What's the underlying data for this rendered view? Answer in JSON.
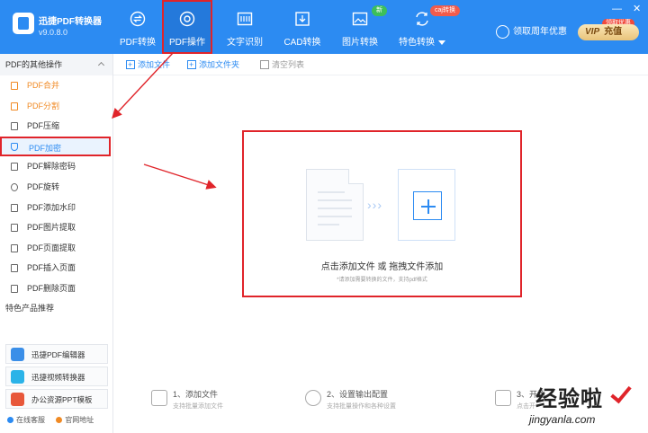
{
  "app": {
    "name": "迅捷PDF转换器",
    "version": "v9.0.8.0"
  },
  "nav": [
    {
      "label": "PDF转换",
      "icon": "convert-icon"
    },
    {
      "label": "PDF操作",
      "icon": "pdf-operate-icon",
      "active": true
    },
    {
      "label": "文字识别",
      "icon": "ocr-icon"
    },
    {
      "label": "CAD转换",
      "icon": "cad-icon"
    },
    {
      "label": "图片转换",
      "icon": "image-icon",
      "badge": "新"
    },
    {
      "label": "特色转换",
      "icon": "special-icon",
      "badge": "caj转换"
    }
  ],
  "header": {
    "user_label": "领取周年优惠",
    "vip_label": "VIP",
    "recharge_label": "充值",
    "vip_tag": "领取优惠"
  },
  "window_controls": {
    "minimize": "—",
    "close": "✕"
  },
  "sidebar": {
    "title": "PDF的其他操作",
    "items": [
      {
        "label": "PDF合并",
        "style": "orange"
      },
      {
        "label": "PDF分割",
        "style": "orange"
      },
      {
        "label": "PDF压缩"
      },
      {
        "label": "PDF加密",
        "selected": true
      },
      {
        "label": "PDF解除密码"
      },
      {
        "label": "PDF旋转"
      },
      {
        "label": "PDF添加水印"
      },
      {
        "label": "PDF图片提取"
      },
      {
        "label": "PDF页面提取"
      },
      {
        "label": "PDF插入页面"
      },
      {
        "label": "PDF删除页面"
      }
    ],
    "recommend_title": "特色产品推荐",
    "recommend": [
      {
        "label": "迅捷PDF编辑器",
        "color": "#3b8fe8"
      },
      {
        "label": "迅捷视频转换器",
        "color": "#2bb3e8"
      },
      {
        "label": "办公资源PPT模板",
        "color": "#e8583b"
      }
    ],
    "footer": {
      "service": "在线客服",
      "website": "官网地址"
    }
  },
  "toolbar": {
    "add_file": "添加文件",
    "add_folder": "添加文件夹",
    "clear_list": "清空列表"
  },
  "dropzone": {
    "title": "点击添加文件 或 拖拽文件添加",
    "hint": "*请添加需要转换的文件，支持pdf格式",
    "arrows": "›››"
  },
  "steps": [
    {
      "title": "1、添加文件",
      "desc": "支持批量添加文件"
    },
    {
      "title": "2、设置输出配置",
      "desc": "支持批量操作和各种设置"
    },
    {
      "title": "3、开始",
      "desc": "点击开"
    }
  ],
  "watermark": {
    "cn": "经验啦",
    "url": "jingyanla.com"
  },
  "colors": {
    "brand": "#2c8bf2",
    "highlight": "#e0242a",
    "accent_orange": "#f08a24"
  }
}
